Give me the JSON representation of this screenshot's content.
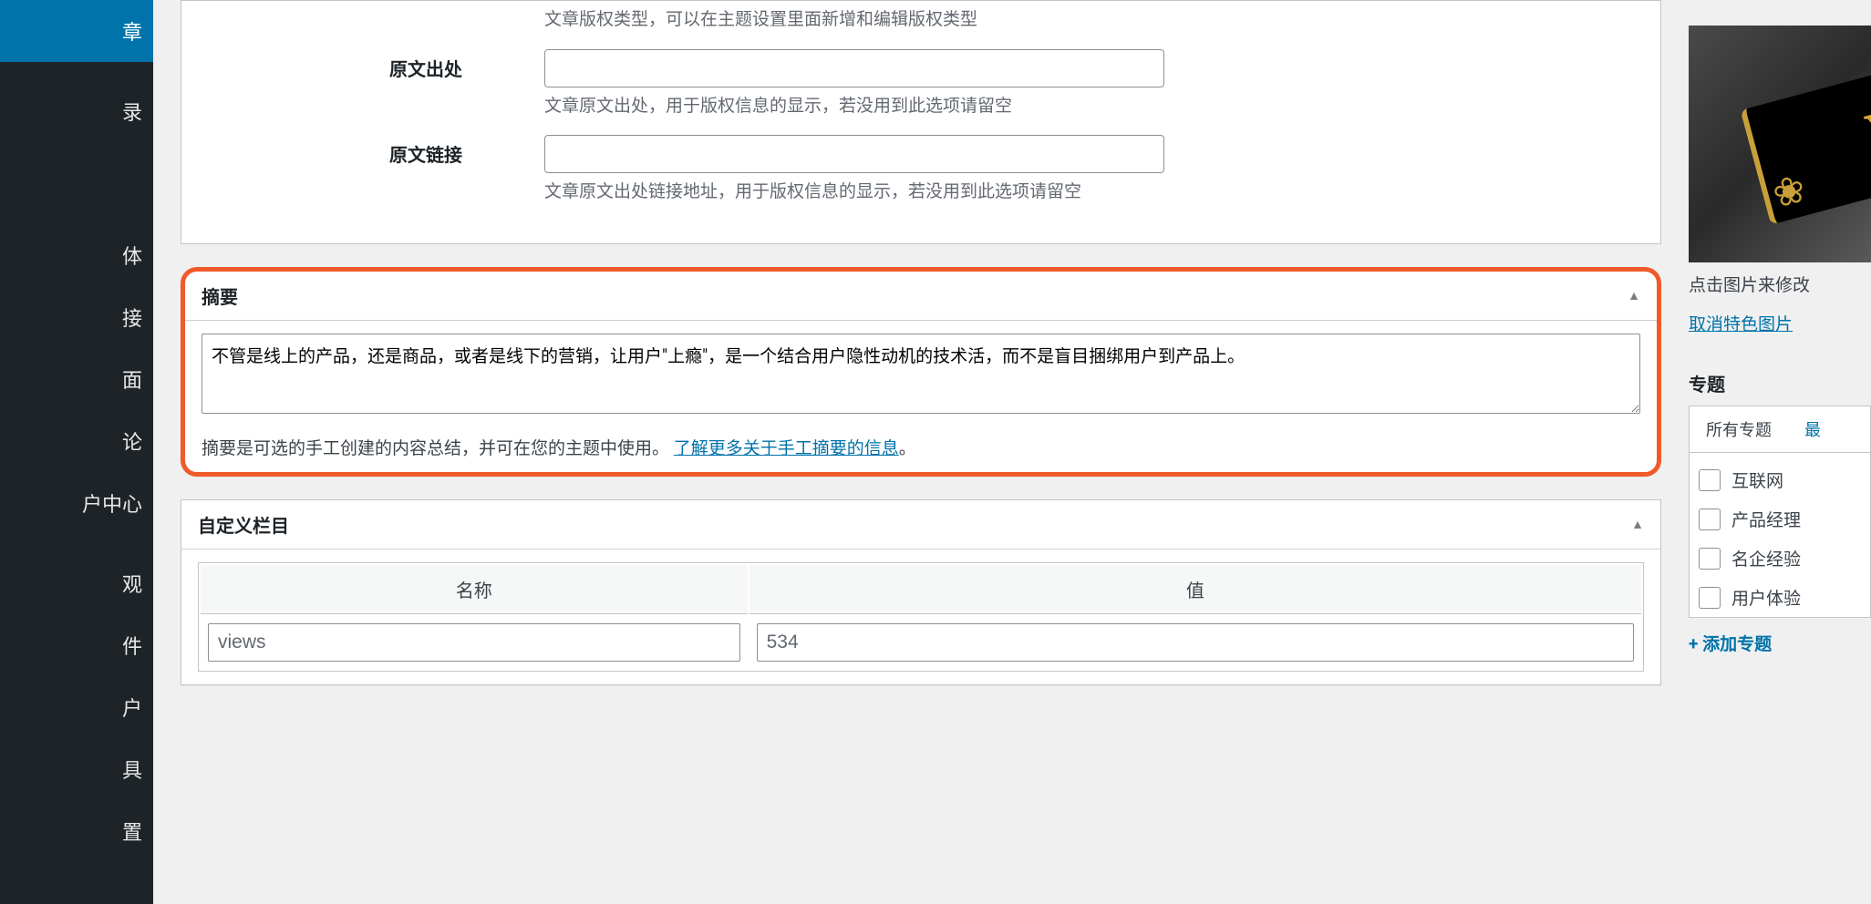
{
  "sidebar": {
    "items": [
      {
        "label": "章"
      },
      {
        "label": "录"
      },
      {
        "label": "体"
      },
      {
        "label": "接"
      },
      {
        "label": "面"
      },
      {
        "label": "论"
      },
      {
        "label": "户中心"
      },
      {
        "label": "观"
      },
      {
        "label": "件"
      },
      {
        "label": "户"
      },
      {
        "label": "具"
      },
      {
        "label": "置"
      }
    ]
  },
  "form": {
    "copyright_type_desc": "文章版权类型，可以在主题设置里面新增和编辑版权类型",
    "source_label": "原文出处",
    "source_desc": "文章原文出处，用于版权信息的显示，若没用到此选项请留空",
    "link_label": "原文链接",
    "link_desc": "文章原文出处链接地址，用于版权信息的显示，若没用到此选项请留空"
  },
  "excerpt": {
    "title": "摘要",
    "content": "不管是线上的产品，还是商品，或者是线下的营销，让用户\"上瘾\"，是一个结合用户隐性动机的技术活，而不是盲目捆绑用户到产品上。",
    "desc_prefix": "摘要是可选的手工创建的内容总结，并可在您的主题中使用。",
    "desc_link": "了解更多关于手工摘要的信息",
    "desc_suffix": "。"
  },
  "custom_fields": {
    "title": "自定义栏目",
    "name_header": "名称",
    "value_header": "值",
    "rows": [
      {
        "name": "views",
        "value": "534"
      }
    ]
  },
  "featured": {
    "click_text": "点击图片来修改",
    "remove_text": "取消特色图片"
  },
  "topics": {
    "title": "专题",
    "tab_all": "所有专题",
    "tab_recent": "最",
    "items": [
      "互联网",
      "产品经理",
      "名企经验",
      "用户体验"
    ],
    "add_text": "+ 添加专题"
  }
}
